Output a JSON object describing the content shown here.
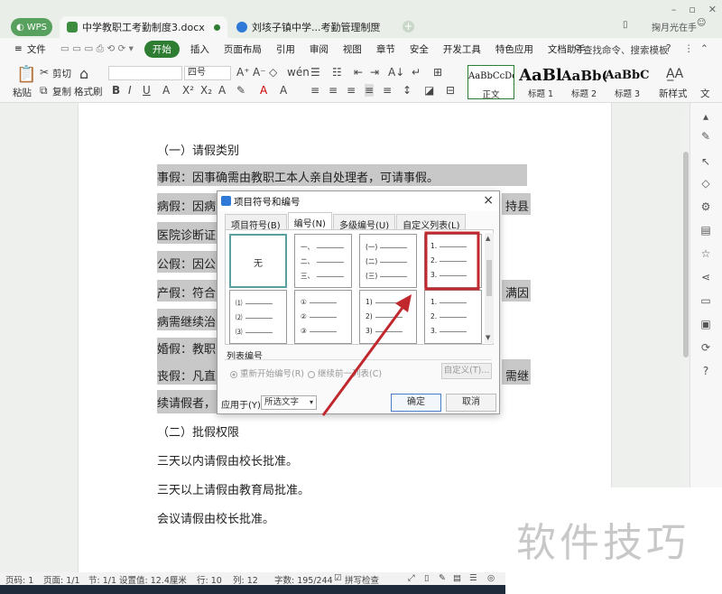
{
  "titlebar": {
    "wps_label": "WPS",
    "tabs": [
      {
        "label": "中学教职工考勤制度3.docx"
      },
      {
        "label": "刘垓子镇中学...考勤管理制度"
      }
    ],
    "user_name": "掬月光在手"
  },
  "menubar": {
    "file_label": "文件",
    "items": [
      "开始",
      "插入",
      "页面布局",
      "引用",
      "审阅",
      "视图",
      "章节",
      "安全",
      "开发工具",
      "特色应用",
      "文档助手"
    ],
    "search_label": "查找命令、搜索模板"
  },
  "toolbar": {
    "paste_label": "粘贴",
    "cut_label": "剪切",
    "copy_label": "复制",
    "format_painter_label": "格式刷",
    "font_size_value": "四号",
    "styles": [
      {
        "sample": "AaBbCcDd",
        "caption": "正文"
      },
      {
        "sample": "AaBl",
        "caption": "标题 1"
      },
      {
        "sample": "AaBb(",
        "caption": "标题 2"
      },
      {
        "sample": "AaBbC",
        "caption": "标题 3"
      }
    ],
    "new_style_label": "新样式",
    "text_label": "文"
  },
  "document": {
    "lines": [
      "（一）请假类别",
      "事假：因事确需由教职工本人亲自处理者，可请事假。",
      "病假：因病",
      "持县",
      "医院诊断证",
      "公假：因公",
      "产假：符合",
      "满因",
      "病需继续治",
      "婚假：教职",
      "丧假：凡直",
      "需继",
      "续请假者，",
      "（二）批假权限",
      "三天以内请假由校长批准。",
      "三天以上请假由教育局批准。",
      "会议请假由校长批准。"
    ]
  },
  "dialog": {
    "title": "项目符号和编号",
    "tabs": [
      "项目符号(B)",
      "编号(N)",
      "多级编号(U)",
      "自定义列表(L)"
    ],
    "none_label": "无",
    "formats": [
      [
        "一、",
        "二、",
        "三、"
      ],
      [
        "(一)",
        "(二)",
        "(三)"
      ],
      [
        "1.",
        "2.",
        "3."
      ],
      [
        "⑴",
        "⑵",
        "⑶"
      ],
      [
        "①",
        "②",
        "③"
      ],
      [
        "1)",
        "2)",
        "3)"
      ],
      [
        "1.",
        "2.",
        "3."
      ]
    ],
    "list_numbering_label": "列表编号",
    "restart_label": "重新开始编号(R)",
    "continue_label": "继续前一列表(C)",
    "customize_label": "自定义(T)...",
    "apply_to_label": "应用于(Y):",
    "apply_to_value": "所选文字",
    "ok_label": "确定",
    "cancel_label": "取消"
  },
  "statusbar": {
    "page_num": "页码: 1",
    "pages": "页面: 1/1",
    "section": "节: 1/1",
    "position": "设置值: 12.4厘米",
    "row": "行: 10",
    "col": "列: 12",
    "word_count": "字数: 195/244",
    "spellcheck": "拼写检查"
  },
  "watermark": "软件技巧",
  "colors": {
    "brand_green": "#2e7d33",
    "highlight_red": "#c0282d",
    "selection_gray": "#c8c8c8"
  }
}
